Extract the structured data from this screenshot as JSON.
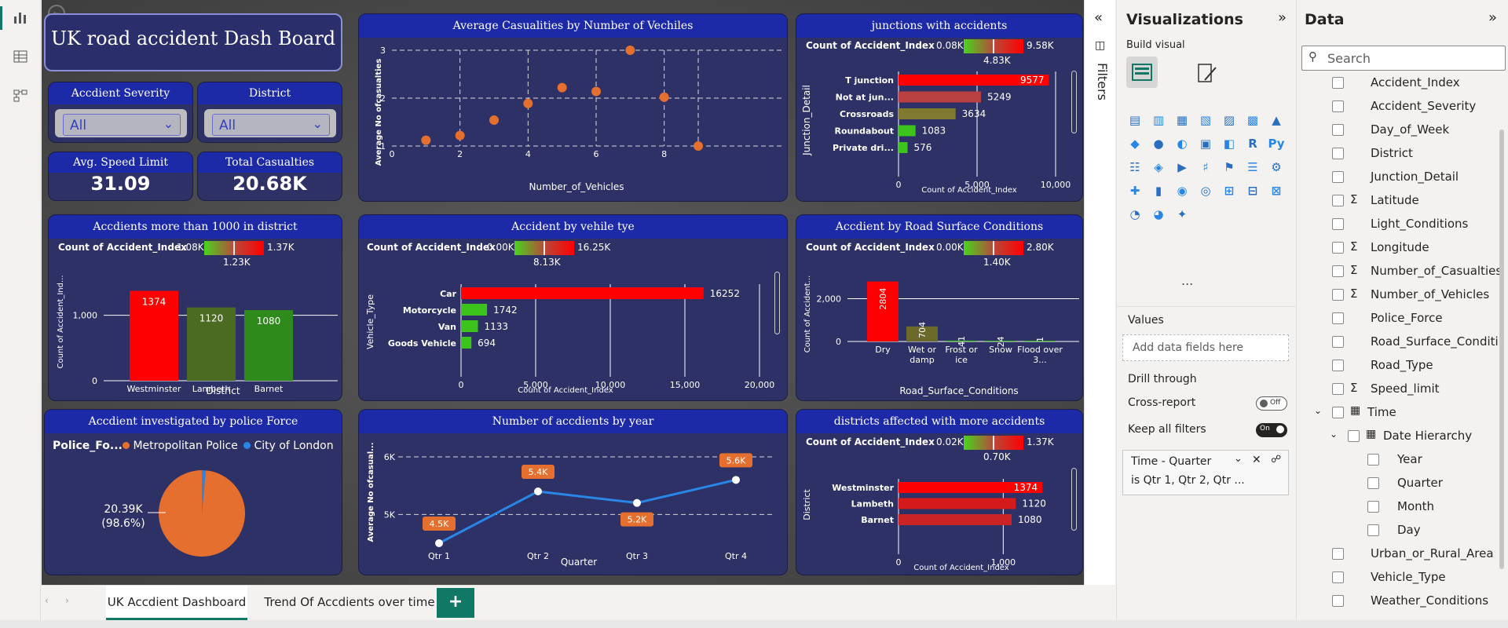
{
  "dashboard": {
    "title": "UK road accident Dash Board",
    "slicers": [
      {
        "label": "Accdient Severity",
        "value": "All"
      },
      {
        "label": "District",
        "value": "All"
      }
    ],
    "kpis": [
      {
        "label": "Avg. Speed Limit",
        "value": "31.09"
      },
      {
        "label": "Total Casualties",
        "value": "20.68K"
      }
    ]
  },
  "scatter": {
    "title": "Average Casualities by Number of Vechiles",
    "xlabel": "Number_of_Vehicles",
    "ylabel": "Average No ofcasualties",
    "xticks": [
      "0",
      "2",
      "4",
      "6",
      "8"
    ],
    "yticks": [
      "1",
      "2",
      "3"
    ],
    "chart_data": {
      "type": "scatter",
      "x": [
        1,
        2,
        3,
        4,
        5,
        6,
        7,
        8,
        9
      ],
      "y": [
        1.12,
        1.22,
        1.54,
        1.89,
        2.22,
        2.14,
        3.0,
        2.02,
        1.0
      ],
      "xlim": [
        0,
        9
      ],
      "ylim": [
        1,
        3
      ],
      "grid": true
    }
  },
  "junctions": {
    "title": "junctions with accidents",
    "legend": {
      "label": "Count of Accident_Index",
      "min": "0.08K",
      "max": "9.58K",
      "avg": "4.83K"
    },
    "ylabel": "Junction_Detail",
    "xlabel": "Count of Accident_Index",
    "xticks": [
      "0",
      "5,000",
      "10,000"
    ],
    "chart_data": {
      "type": "bar",
      "categories": [
        "T junction",
        "Not at jun...",
        "Crossroads",
        "Roundabout",
        "Private dri..."
      ],
      "values": [
        9577,
        5249,
        3634,
        1083,
        576
      ],
      "colors": [
        "#ff0000",
        "#b84040",
        "#7f7a30",
        "#3cc41c",
        "#3cc41c"
      ],
      "xlim": [
        0,
        10000
      ]
    }
  },
  "district_bars": {
    "title": "Accdients more than 1000 in district",
    "legend": {
      "label": "Count of Accident_Index",
      "min": "1.08K",
      "max": "1.37K",
      "avg": "1.23K"
    },
    "ylabel": "Count of Accident_Ind...",
    "xlabel": "District",
    "yticks": [
      "0",
      "1,000"
    ],
    "chart_data": {
      "type": "bar",
      "categories": [
        "Westminster",
        "Lambeth",
        "Barnet"
      ],
      "values": [
        1374,
        1120,
        1080
      ],
      "colors": [
        "#ff0000",
        "#4b6a22",
        "#2d8a1b"
      ],
      "ylim": [
        0,
        1500
      ]
    }
  },
  "vehicle": {
    "title": "Accident by vehile tye",
    "legend": {
      "label": "Count of Accident_Index",
      "min": "0.00K",
      "max": "16.25K",
      "avg": "8.13K"
    },
    "ylabel": "Vehicle_Type",
    "xlabel": "Count of Accident_Index",
    "xticks": [
      "0",
      "5,000",
      "10,000",
      "15,000",
      "20,000"
    ],
    "chart_data": {
      "type": "bar",
      "categories": [
        "Car",
        "Motorcycle",
        "Van",
        "Goods Vehicle"
      ],
      "values": [
        16252,
        1742,
        1133,
        694
      ],
      "colors": [
        "#ff0000",
        "#3cc41c",
        "#3cc41c",
        "#3cc41c"
      ],
      "xlim": [
        0,
        20000
      ]
    }
  },
  "surface": {
    "title": "Accdient by Road Surface Conditions",
    "legend": {
      "label": "Count of Accident_Index",
      "min": "0.00K",
      "max": "2.80K",
      "avg": "1.40K"
    },
    "ylabel": "Count of Accident...",
    "xlabel": "Road_Surface_Conditions",
    "yticks": [
      "0",
      "2,000"
    ],
    "chart_data": {
      "type": "bar",
      "categories": [
        "Dry",
        "Wet or damp",
        "Frost or ice",
        "Snow",
        "Flood over 3..."
      ],
      "values": [
        2804,
        704,
        41,
        24,
        1
      ],
      "colors": [
        "#ff0000",
        "#6b6a2a",
        "#3cc41c",
        "#3cc41c",
        "#3cc41c"
      ],
      "ylim": [
        0,
        2900
      ]
    }
  },
  "police": {
    "title": "Accdient investigated by police Force",
    "legend_title": "Police_Fo...",
    "legend_items": [
      {
        "name": "Metropolitan Police",
        "color": "#e46f2f"
      },
      {
        "name": "City of London",
        "color": "#2a86e6"
      }
    ],
    "slice_label": "20.39K",
    "slice_pct": "(98.6%)",
    "chart_data": {
      "type": "pie",
      "categories": [
        "Metropolitan Police",
        "City of London"
      ],
      "values": [
        20390,
        290
      ]
    }
  },
  "yearly": {
    "title": "Number of accdients by year",
    "xlabel": "Quarter",
    "ylabel": "Average No ofcasual...",
    "yticks": [
      "5K",
      "6K"
    ],
    "chart_data": {
      "type": "line",
      "categories": [
        "Qtr 1",
        "Qtr 2",
        "Qtr 3",
        "Qtr 4"
      ],
      "values": [
        4500,
        5400,
        5200,
        5600
      ],
      "labels": [
        "4.5K",
        "5.4K",
        "5.2K",
        "5.6K"
      ],
      "ylim": [
        4500,
        6000
      ]
    }
  },
  "districts_affected": {
    "title": "districts affected with more accidents",
    "legend": {
      "label": "Count of Accident_Index",
      "min": "0.02K",
      "max": "1.37K",
      "avg": "0.70K"
    },
    "ylabel": "District",
    "xlabel": "Count of Accident_Index",
    "xticks": [
      "0",
      "1,000"
    ],
    "chart_data": {
      "type": "bar",
      "categories": [
        "Westminster",
        "Lambeth",
        "Barnet"
      ],
      "values": [
        1374,
        1120,
        1080
      ],
      "colors": [
        "#ff0000",
        "#d41a1a",
        "#cc2424"
      ],
      "xlim": [
        0,
        1500
      ]
    }
  },
  "filters_label": "Filters",
  "visualizations": {
    "title": "Visualizations",
    "build_visual": "Build visual",
    "values_label": "Values",
    "values_placeholder": "Add data fields here",
    "drill_through": "Drill through",
    "cross_report": "Cross-report",
    "cross_report_state": "Off",
    "keep_filters": "Keep all filters",
    "keep_filters_state": "On",
    "filter_card_title": "Time - Quarter",
    "filter_card_value": "is Qtr 1, Qtr 2, Qtr ...",
    "more": "..."
  },
  "data_pane": {
    "title": "Data",
    "search_placeholder": "Search",
    "fields": [
      {
        "name": "Accident_Index",
        "sigma": false,
        "indent": 0
      },
      {
        "name": "Accident_Severity",
        "sigma": false,
        "indent": 0
      },
      {
        "name": "Day_of_Week",
        "sigma": false,
        "indent": 0
      },
      {
        "name": "District",
        "sigma": false,
        "indent": 0
      },
      {
        "name": "Junction_Detail",
        "sigma": false,
        "indent": 0
      },
      {
        "name": "Latitude",
        "sigma": true,
        "indent": 0
      },
      {
        "name": "Light_Conditions",
        "sigma": false,
        "indent": 0
      },
      {
        "name": "Longitude",
        "sigma": true,
        "indent": 0
      },
      {
        "name": "Number_of_Casualties",
        "sigma": true,
        "indent": 0
      },
      {
        "name": "Number_of_Vehicles",
        "sigma": true,
        "indent": 0
      },
      {
        "name": "Police_Force",
        "sigma": false,
        "indent": 0
      },
      {
        "name": "Road_Surface_Conditi...",
        "sigma": false,
        "indent": 0
      },
      {
        "name": "Road_Type",
        "sigma": false,
        "indent": 0
      },
      {
        "name": "Speed_limit",
        "sigma": true,
        "indent": 0
      },
      {
        "name": "Time",
        "sigma": false,
        "indent": 0,
        "table": true
      },
      {
        "name": "Date Hierarchy",
        "sigma": false,
        "indent": 1
      },
      {
        "name": "Year",
        "sigma": false,
        "indent": 2
      },
      {
        "name": "Quarter",
        "sigma": false,
        "indent": 2
      },
      {
        "name": "Month",
        "sigma": false,
        "indent": 2
      },
      {
        "name": "Day",
        "sigma": false,
        "indent": 2
      },
      {
        "name": "Urban_or_Rural_Area",
        "sigma": false,
        "indent": 0
      },
      {
        "name": "Vehicle_Type",
        "sigma": false,
        "indent": 0
      },
      {
        "name": "Weather_Conditions",
        "sigma": false,
        "indent": 0
      }
    ]
  },
  "tabs": [
    {
      "label": "UK Accdient Dashboard",
      "active": true
    },
    {
      "label": "Trend Of Accdients over time",
      "active": false
    }
  ],
  "add_tab": "+"
}
